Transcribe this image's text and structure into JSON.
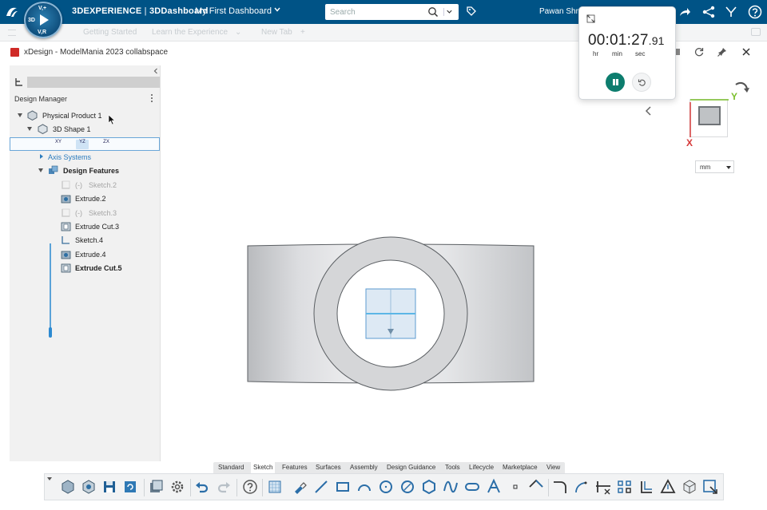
{
  "topbar": {
    "brand_bold": "3DEXPERIENCE",
    "brand_sep": " | ",
    "brand_app": "3DDashboard",
    "dashboard_title": "My First Dashboard",
    "search_placeholder": "Search",
    "user_name": "Pawan Shr",
    "compass": {
      "top": "V,+",
      "left": "3D",
      "right": "V,R"
    }
  },
  "tabs": {
    "items": [
      "Getting Started",
      "Learn the Experience",
      "New Tab"
    ]
  },
  "app": {
    "title": "xDesign - ModelMania 2023 collabspace"
  },
  "design_manager": {
    "title": "Design Manager",
    "tree": {
      "root": "Physical Product 1",
      "shape": "3D Shape 1",
      "planes": [
        "XY",
        "YZ",
        "ZX"
      ],
      "axis_systems": "Axis Systems",
      "features_group": "Design Features",
      "features": [
        {
          "prefix": "(-)",
          "label": "Sketch.2",
          "state": "hidden"
        },
        {
          "prefix": "",
          "label": "Extrude.2",
          "state": "normal"
        },
        {
          "prefix": "(-)",
          "label": "Sketch.3",
          "state": "hidden"
        },
        {
          "prefix": "",
          "label": "Extrude Cut.3",
          "state": "normal"
        },
        {
          "prefix": "",
          "label": "Sketch.4",
          "state": "normal"
        },
        {
          "prefix": "",
          "label": "Extrude.4",
          "state": "normal"
        },
        {
          "prefix": "",
          "label": "Extrude Cut.5",
          "state": "active"
        }
      ]
    }
  },
  "viewport": {
    "axis_x": "X",
    "axis_y": "Y",
    "unit": "mm"
  },
  "timer": {
    "hh": "00",
    "mm": "01",
    "ss": "27",
    "cs": ".91",
    "unit_hr": "hr",
    "unit_min": "min",
    "unit_sec": "sec"
  },
  "section_tabs": [
    "Standard",
    "Sketch",
    "Features",
    "Surfaces",
    "Assembly",
    "Design Guidance",
    "Tools",
    "Lifecycle",
    "Marketplace",
    "View"
  ],
  "active_section": "Sketch",
  "colors": {
    "topbar": "#005386",
    "accent": "#2b7bbd",
    "timer_button": "#0d7d6e",
    "x_axis": "#d63a3a",
    "y_axis": "#7bbf2d"
  }
}
